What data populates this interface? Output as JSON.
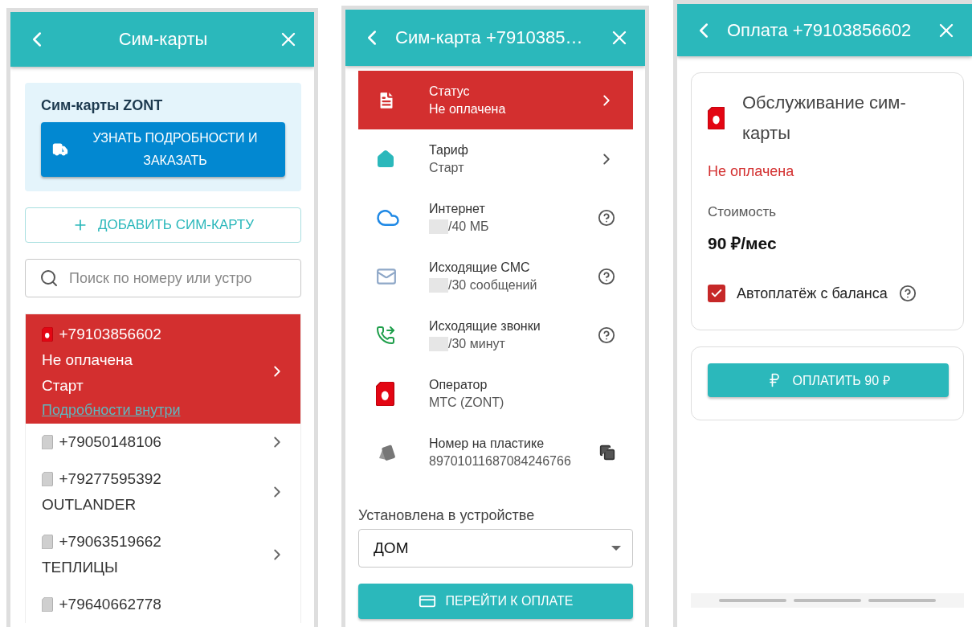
{
  "sim_list_screen": {
    "header": {
      "title": "Сим-карты"
    },
    "promo": {
      "title": "Сим-карты ZONT",
      "button": "УЗНАТЬ ПОДРОБНОСТИ И ЗАКАЗАТЬ"
    },
    "add_button": "ДОБАВИТЬ СИМ-КАРТУ",
    "search": {
      "placeholder": "Поиск по номеру или устро"
    },
    "sims": [
      {
        "number": "+79103856602",
        "lines": [
          "Не оплачена",
          "Старт"
        ],
        "link": "Подробности внутри",
        "alert": true
      },
      {
        "number": "+79050148106",
        "alert": false
      },
      {
        "number": "+79277595392",
        "lines": [
          "OUTLANDER"
        ],
        "alert": false
      },
      {
        "number": "+79063519662",
        "lines": [
          "ТЕПЛИЦЫ"
        ],
        "alert": false
      },
      {
        "number": "+79640662778",
        "alert": false
      }
    ]
  },
  "sim_details_screen": {
    "header": {
      "title": "Сим-карта +7910385…"
    },
    "rows": [
      {
        "label": "Статус",
        "value": "Не оплачена",
        "alert": true,
        "masked": false
      },
      {
        "label": "Тариф",
        "value": "Старт",
        "alert": false,
        "masked": false
      },
      {
        "label": "Интернет",
        "value": "/40 МБ",
        "alert": false,
        "masked": true
      },
      {
        "label": "Исходящие СМС",
        "value": "/30 сообщений",
        "alert": false,
        "masked": true
      },
      {
        "label": "Исходящие звонки",
        "value": "/30 минут",
        "alert": false,
        "masked": true
      },
      {
        "label": "Оператор",
        "value": "МТС (ZONT)",
        "alert": false,
        "masked": false
      },
      {
        "label": "Номер на пластике",
        "value": "89701011687084246766",
        "alert": false,
        "masked": false
      }
    ],
    "device_select": {
      "label": "Установлена в устройстве",
      "value": "ДОМ"
    },
    "pay_button": "ПЕРЕЙТИ К ОПЛАТЕ"
  },
  "payment_screen": {
    "header": {
      "title": "Оплата +79103856602"
    },
    "service": {
      "title": "Обслуживание сим-карты",
      "status": "Не оплачена",
      "cost_label": "Стоимость",
      "price": "90 ₽/мес"
    },
    "autopay": {
      "label": "Автоплатёж с баланса",
      "checked": true
    },
    "pay_button": "ОПЛАТИТЬ 90 ₽"
  }
}
